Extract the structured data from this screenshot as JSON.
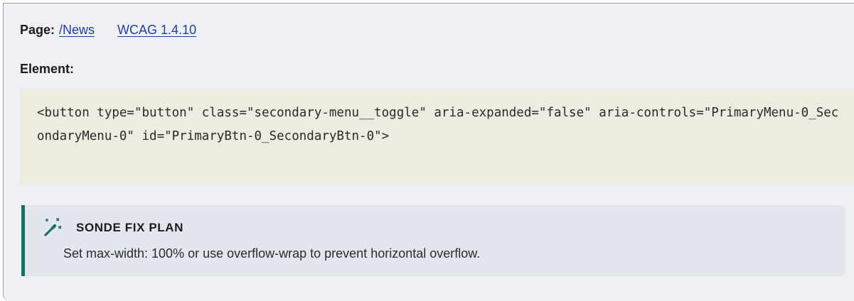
{
  "page": {
    "label": "Page:",
    "path_link": "/News",
    "wcag_link": "WCAG 1.4.10"
  },
  "element": {
    "label": "Element:",
    "code": "<button type=\"button\" class=\"secondary-menu__toggle\" aria-expanded=\"false\" aria-controls=\"PrimaryMenu-0_SecondaryMenu-0\" id=\"PrimaryBtn-0_SecondaryBtn-0\">"
  },
  "fix_plan": {
    "icon": "magic-wand-icon",
    "title": "SONDE FIX PLAN",
    "text": "Set max-width: 100% or use overflow-wrap to prevent horizontal overflow."
  },
  "colors": {
    "card_bg": "#eff0f4",
    "link": "#1f3f9f",
    "code_bg": "#eeebe1",
    "fix_bg": "#e3e6ec",
    "fix_accent": "#1b6e64"
  }
}
